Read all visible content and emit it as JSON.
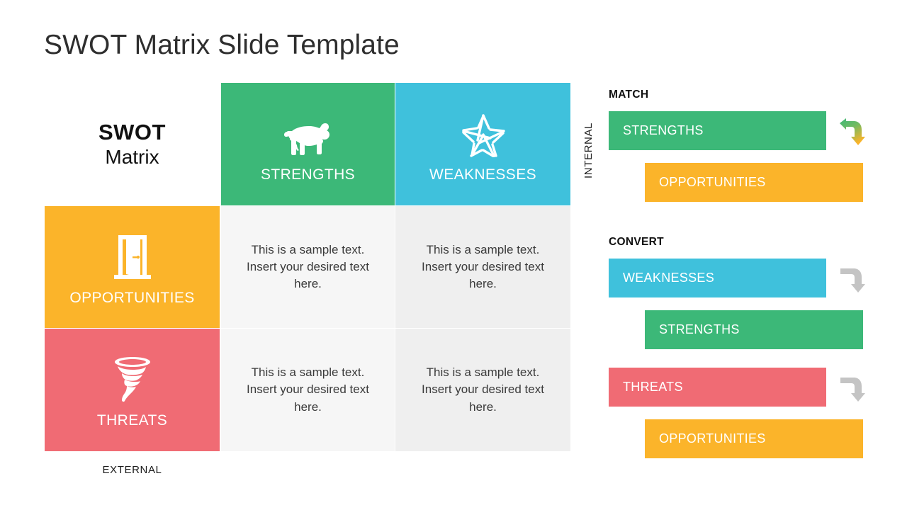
{
  "slide": {
    "title": "SWOT Matrix Slide Template"
  },
  "colors": {
    "strengths": "#3cb878",
    "weaknesses": "#3fc1dc",
    "opportunities": "#fbb42a",
    "threats": "#f06b74",
    "cell_light": "#f6f6f6",
    "cell_light_alt": "#efefef",
    "title_text": "#2e2e2e",
    "arrow_gray": "#c4c4c4"
  },
  "matrix": {
    "header": {
      "line1": "SWOT",
      "line2": "Matrix"
    },
    "axes": {
      "vertical": "INTERNAL",
      "horizontal": "EXTERNAL"
    },
    "quadrants": {
      "strengths": {
        "label": "STRENGTHS",
        "icon": "ram-icon"
      },
      "weaknesses": {
        "label": "WEAKNESSES",
        "icon": "broken-star-icon"
      },
      "opportunities": {
        "label": "OPPORTUNITIES",
        "icon": "open-door-icon"
      },
      "threats": {
        "label": "THREATS",
        "icon": "tornado-icon"
      }
    },
    "content_cells": [
      {
        "text": "This is a sample text. Insert your desired text here."
      },
      {
        "text": "This is a sample text. Insert your desired text here."
      },
      {
        "text": "This is a sample text. Insert your desired text here."
      },
      {
        "text": "This is a sample text. Insert your desired text here."
      }
    ]
  },
  "strategy_panel": {
    "groups": [
      {
        "title": "MATCH",
        "top_bar": "STRENGTHS",
        "bottom_bar": "OPPORTUNITIES",
        "arrow": "curved-arrow-gradient-icon"
      },
      {
        "title": "CONVERT",
        "top_bar": "WEAKNESSES",
        "bottom_bar": "STRENGTHS",
        "arrow": "curved-arrow-gray-icon"
      },
      {
        "title": "",
        "top_bar": "THREATS",
        "bottom_bar": "OPPORTUNITIES",
        "arrow": "curved-arrow-gray-icon"
      }
    ]
  }
}
